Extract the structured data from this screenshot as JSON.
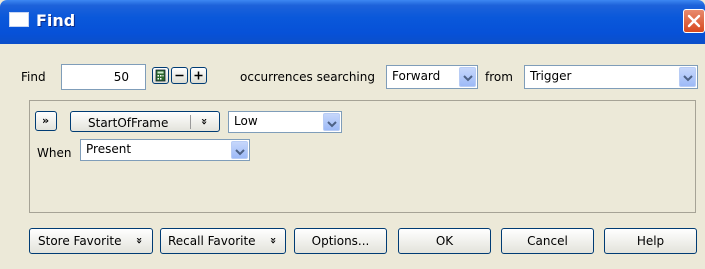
{
  "window": {
    "title": "Find"
  },
  "icons": {
    "window": "window-icon",
    "close": "close-icon",
    "calc": "calculator-icon",
    "minus": "minus-icon",
    "plus": "plus-icon",
    "chevron": "double-chevron-down-icon"
  },
  "find_row": {
    "find_label": "Find",
    "count_value": "50",
    "occurrences_label": "occurrences searching",
    "direction_value": "Forward",
    "from_label": "from",
    "from_value": "Trigger"
  },
  "condition": {
    "field_value": "StartOfFrame",
    "level_value": "Low",
    "when_label": "When",
    "when_value": "Present"
  },
  "footer": {
    "store_favorite": "Store Favorite",
    "recall_favorite": "Recall Favorite",
    "options": "Options...",
    "ok": "OK",
    "cancel": "Cancel",
    "help": "Help"
  }
}
